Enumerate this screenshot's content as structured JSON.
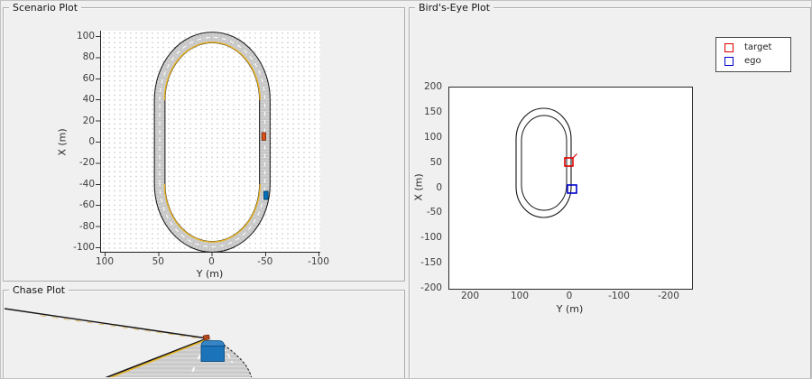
{
  "window": {
    "background": "#f0f0f0"
  },
  "panels": {
    "scenario": {
      "title": "Scenario Plot"
    },
    "chase": {
      "title": "Chase Plot"
    },
    "birdseye": {
      "title": "Bird's-Eye Plot"
    }
  },
  "chart_data": [
    {
      "id": "scenario-plot",
      "type": "line",
      "title": "Scenario Plot",
      "xlabel": "Y (m)",
      "ylabel": "X (m)",
      "x_ticks": [
        "100",
        "50",
        "0",
        "-50",
        "-100"
      ],
      "y_ticks": [
        "100",
        "80",
        "60",
        "40",
        "20",
        "0",
        "-20",
        "-40",
        "-60",
        "-80",
        "-100"
      ],
      "x_range": [
        100,
        -100
      ],
      "x_axis_reversed": true,
      "y_range": [
        -100,
        100
      ],
      "grid": "dotted",
      "road": {
        "shape": "oval racetrack (stadium loop), two lanes",
        "straight_sides_at_y_m": [
          50,
          -50
        ],
        "extent_x_m": [
          -100,
          100
        ],
        "surface_color": "#c6c6c6",
        "edge_color": "#1c1c1c",
        "center_dash_color": "#ffffff",
        "inner_curve_line_color": "#e9b322"
      },
      "vehicles": [
        {
          "name": "target",
          "color": "#d95319",
          "x_m": 0,
          "y_m": -49
        },
        {
          "name": "ego",
          "color": "#0072bd",
          "x_m": -50,
          "y_m": -49
        }
      ]
    },
    {
      "id": "birdseye-plot",
      "type": "line",
      "title": "Bird's-Eye Plot",
      "xlabel": "Y (m)",
      "ylabel": "X (m)",
      "x_ticks": [
        "200",
        "100",
        "0",
        "-100",
        "-200"
      ],
      "y_ticks": [
        "200",
        "150",
        "100",
        "50",
        "0",
        "-50",
        "-100",
        "-150",
        "-200"
      ],
      "x_range": [
        245,
        -245
      ],
      "x_axis_reversed": true,
      "y_range": [
        -200,
        200
      ],
      "legend": [
        {
          "label": "target",
          "color": "#dd0000"
        },
        {
          "label": "ego",
          "color": "#0000cc"
        }
      ],
      "lane_boundaries": "two concentric oval loops (road edges) in ego coordinates, extent X -55..152 m, Y -5..110 m",
      "actors": [
        {
          "name": "target",
          "x_m": 50,
          "y_m": 3
        },
        {
          "name": "ego",
          "x_m": 0,
          "y_m": 0
        }
      ]
    },
    {
      "id": "chase-plot",
      "type": "3d-chase-view",
      "title": "Chase Plot",
      "description": "Chase-camera view behind the blue ego vehicle on the curving track; orange target vehicle ahead near the horizon",
      "ego": {
        "name": "ego",
        "color": "#1b74ba"
      },
      "target": {
        "name": "target",
        "color": "#b5491d"
      },
      "road_colors": {
        "surface": "#c9c9c9",
        "edge": "#141414",
        "lane_yellow": "#e8b520",
        "lane_white": "#ffffff"
      }
    }
  ]
}
